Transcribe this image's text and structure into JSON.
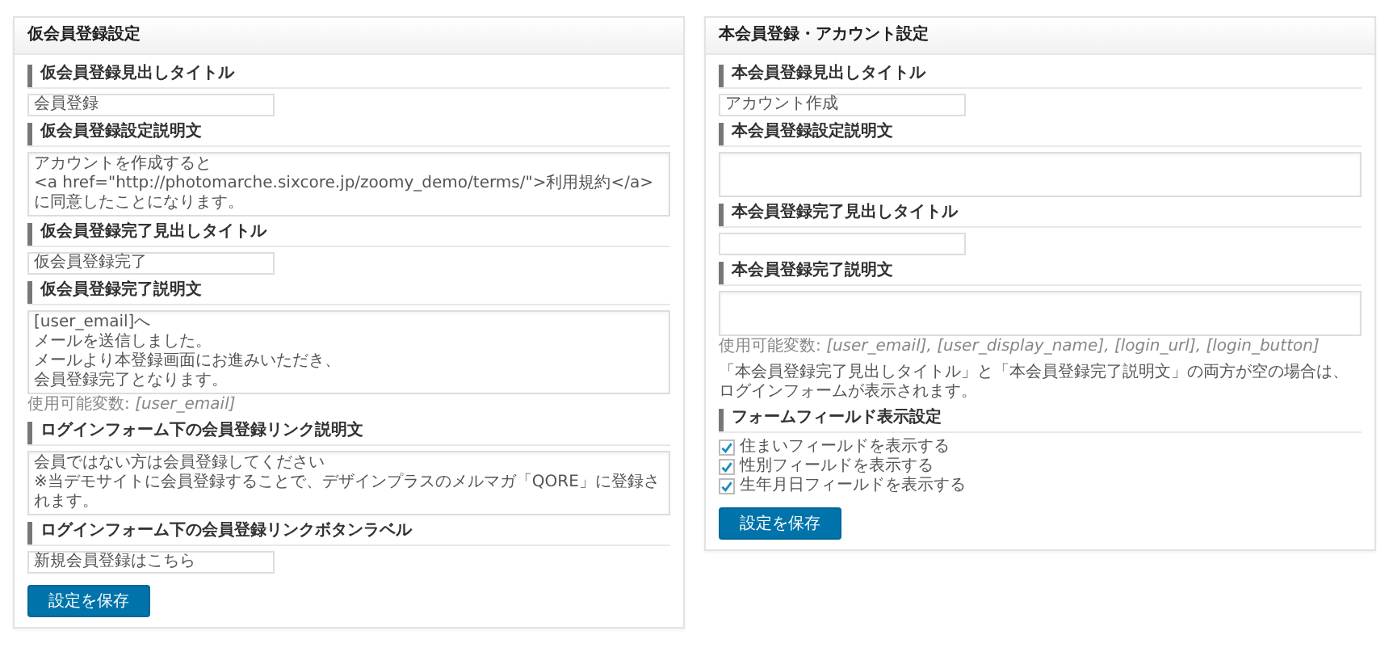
{
  "panels": [
    {
      "title": "仮会員登録設定",
      "sections": [
        {
          "heading": "仮会員登録見出しタイトル",
          "kind": "input",
          "value": "会員登録"
        },
        {
          "heading": "仮会員登録設定説明文",
          "kind": "textarea",
          "lines": [
            "アカウントを作成すると",
            "<a href=\"http://photomarche.sixcore.jp/zoomy_demo/terms/\">利用規約</a>に同意したことになります。"
          ]
        },
        {
          "heading": "仮会員登録完了見出しタイトル",
          "kind": "input",
          "value": "仮会員登録完了"
        },
        {
          "heading": "仮会員登録完了説明文",
          "kind": "textarea",
          "lines": [
            "[user_email]へ",
            "メールを送信しました。",
            "メールより本登録画面にお進みいただき、",
            "会員登録完了となります。"
          ],
          "hint": "使用可能変数: *[user_email]*"
        },
        {
          "heading": "ログインフォーム下の会員登録リンク説明文",
          "kind": "textarea",
          "lines": [
            "会員ではない方は会員登録してください",
            "※当デモサイトに会員登録することで、デザインプラスのメルマガ「QORE」に登録されます。"
          ]
        },
        {
          "heading": "ログインフォーム下の会員登録リンクボタンラベル",
          "kind": "input",
          "value": "新規会員登録はこちら"
        }
      ],
      "button": "設定を保存"
    },
    {
      "title": "本会員登録・アカウント設定",
      "sections": [
        {
          "heading": "本会員登録見出しタイトル",
          "kind": "input",
          "value": "アカウント作成"
        },
        {
          "heading": "本会員登録設定説明文",
          "kind": "textarea"
        },
        {
          "heading": "本会員登録完了見出しタイトル",
          "kind": "input"
        },
        {
          "heading": "本会員登録完了説明文",
          "kind": "textarea",
          "hint": "使用可能変数: *[user_email], [user_display_name], [login_url], [login_button]*",
          "note": "「本会員登録完了見出しタイトル」と「本会員登録完了説明文」の両方が空の場合は、ログインフォームが表示されます。"
        },
        {
          "heading": "フォームフィールド表示設定",
          "kind": "checkboxes",
          "items": [
            {
              "label": "住まいフィールドを表示する",
              "checked": true
            },
            {
              "label": "性別フィールドを表示する",
              "checked": true
            },
            {
              "label": "生年月日フィールドを表示する",
              "checked": true
            }
          ]
        }
      ],
      "button": "設定を保存"
    }
  ]
}
